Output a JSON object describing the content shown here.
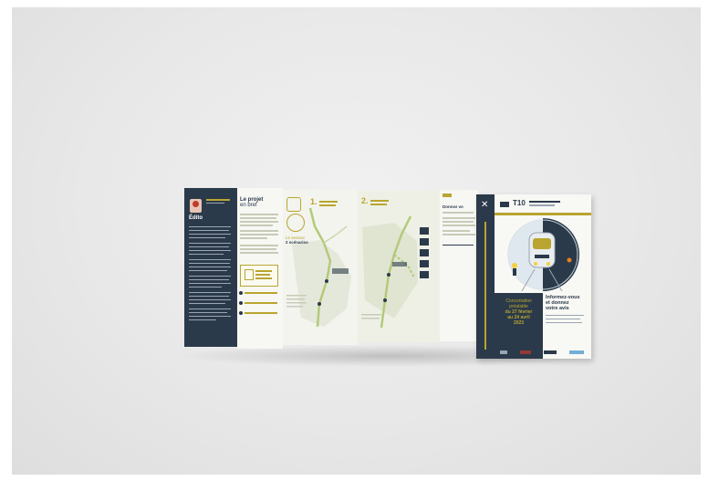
{
  "brochure": {
    "edito_title": "Édito",
    "project_title_line1": "Le projet",
    "project_title_line2": "en bref",
    "scenarios_line1": "Le secteur",
    "scenarios_line2": "2 scénarios",
    "scenario_1_number": "1.",
    "scenario_2_number": "2.",
    "donnez_title": "Donnez vo",
    "cover_line_number": "T10",
    "cover_title_line1": "Informez-vous",
    "cover_title_line2": "et donnez",
    "cover_title_line3": "votre avis",
    "cover_concert_line1": "Concertation",
    "cover_concert_line2": "préalable",
    "cover_concert_line3": "du 27 février",
    "cover_concert_line4": "au 24 avril",
    "cover_concert_line5": "2023"
  },
  "colors": {
    "navy": "#2b3a4a",
    "olive": "#b9a52f",
    "paper": "#f7f7f3",
    "route_green": "#b4c97a"
  }
}
